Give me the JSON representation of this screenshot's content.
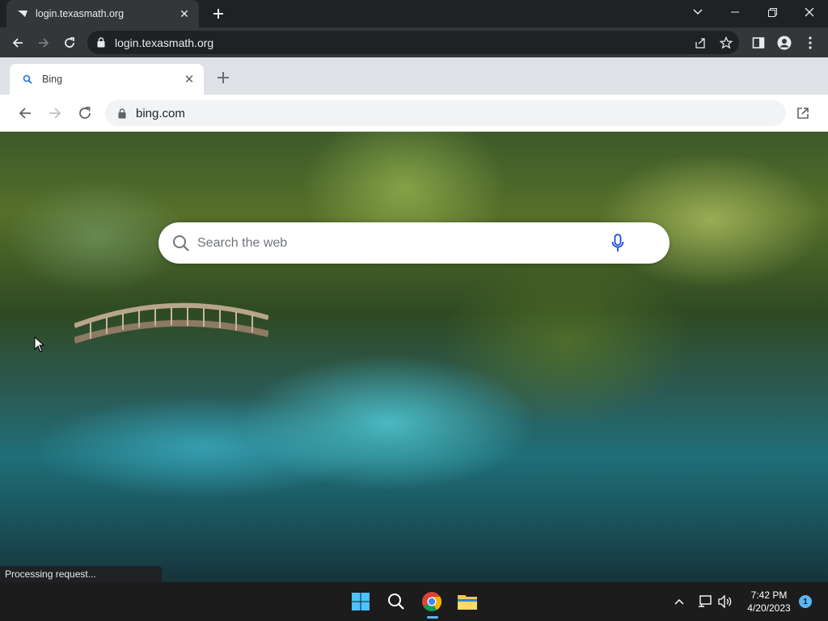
{
  "outer_browser": {
    "tab_title": "login.texasmath.org",
    "url": "login.texasmath.org"
  },
  "inner_browser": {
    "tab_title": "Bing",
    "url": "bing.com"
  },
  "page": {
    "search_placeholder": "Search the web"
  },
  "status_text": "Processing request...",
  "taskbar": {
    "time": "7:42 PM",
    "date": "4/20/2023",
    "notification_count": "1"
  },
  "colors": {
    "outer_chrome": "#202124",
    "inner_chrome": "#dee1e6",
    "bing_mic": "#174ae4",
    "taskbar": "#1c1c1c"
  }
}
